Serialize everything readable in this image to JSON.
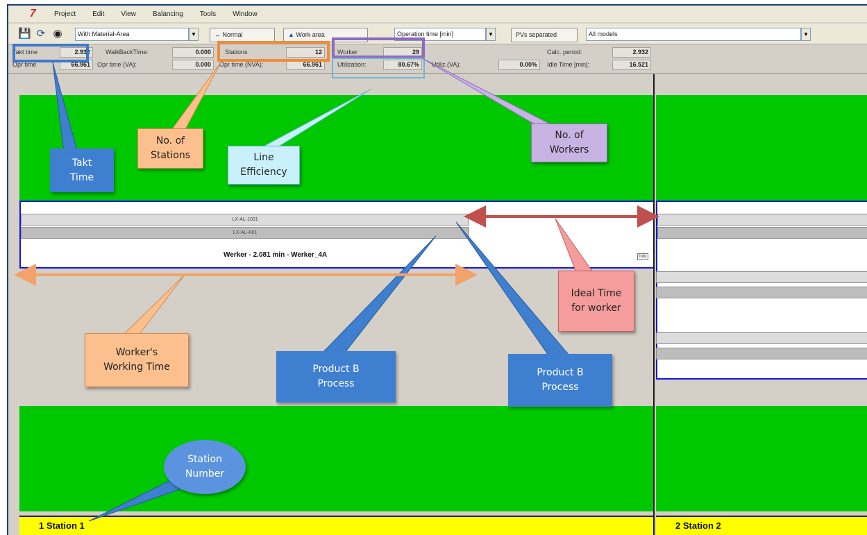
{
  "menu": [
    "Project",
    "Edit",
    "View",
    "Balancing",
    "Tools",
    "Window"
  ],
  "toolbar": {
    "area_select": "With Material-Area",
    "normal_button": "Normal",
    "work_area_button": "Work area",
    "time_select": "Operation time [min]",
    "pvs_button": "PVs separated",
    "model_select": "All models"
  },
  "info": {
    "takt_time_label": "Takt time",
    "takt_time_value": "2.932",
    "walkback_label": "WalkBackTime:",
    "walkback_value": "0.000",
    "stations_label": "Stations",
    "stations_value": "12",
    "worker_label": "Worker",
    "worker_value": "29",
    "calc_period_label": "Calc. period:",
    "calc_period_value": "2.932",
    "opr_time_label": "Opr time",
    "opr_time_value": "66.961",
    "opr_va_label": "Opr time (VA):",
    "opr_va_value": "0.000",
    "opr_nva_label": "Opr time (NVA):",
    "opr_nva_value": "66.961",
    "utilization_label": "Utilization:",
    "utilization_value": "80.67%",
    "utiliz_va_label": "Utiliz.(VA):",
    "utiliz_va_value": "0.00%",
    "idle_label": "Idle Time [min]:",
    "idle_value": "16.521"
  },
  "workspace": {
    "op_bar_1": "LX-AL-1001",
    "op_bar_2": "LX-AL-A01",
    "worker_line": "Werker - 2.081 min  - Werker_4A",
    "info_button": "Info",
    "station_1": "1   Station 1",
    "station_2": "2   Station 2"
  },
  "callouts": {
    "takt": "Takt\nTime",
    "stations": "No. of\nStations",
    "efficiency": "Line\nEfficiency",
    "workers": "No. of\nWorkers",
    "ideal": "Ideal Time\nfor worker",
    "working_time": "Worker's\nWorking Time",
    "product_b_1": "Product B\nProcess",
    "product_b_2": "Product B\nProcess",
    "station_number": "Station\nNumber"
  },
  "colors": {
    "green_area": "#00c800",
    "station_bar": "#ffff00",
    "worker_box_border": "#1717d9",
    "callout_blue": "#3f7fd0",
    "callout_orange": "#fbc08e",
    "callout_cyan": "#c9f1fb",
    "callout_purple": "#c8b4e3",
    "callout_pink": "#f59c9c",
    "arrow_red": "#c0504d",
    "arrow_orange": "#f2a36b"
  }
}
